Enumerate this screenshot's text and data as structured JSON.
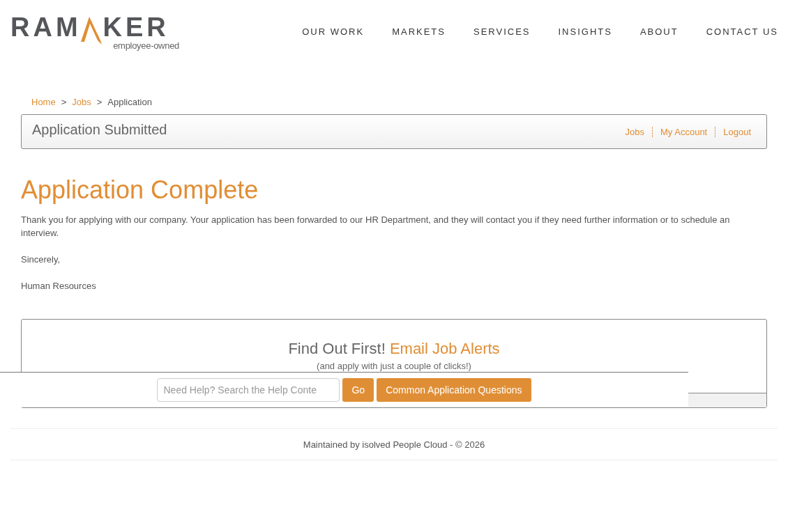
{
  "logo": {
    "left": "RAM",
    "right": "KER",
    "tagline": "employee-owned"
  },
  "nav": [
    "OUR WORK",
    "MARKETS",
    "SERVICES",
    "INSIGHTS",
    "ABOUT",
    "CONTACT US"
  ],
  "breadcrumb": [
    {
      "label": "Home",
      "link": true
    },
    {
      "label": "Jobs",
      "link": true
    },
    {
      "label": "Application",
      "link": false
    }
  ],
  "breadcrumb_separator": ">",
  "panel": {
    "title": "Application Submitted",
    "links": [
      "Jobs",
      "My Account",
      "Logout"
    ]
  },
  "heading": "Application Complete",
  "paragraphs": [
    "Thank you for applying with our company. Your application has been forwarded to our HR Department, and they will contact you if they need further information or to schedule an interview.",
    "Sincerely,",
    "Human Resources"
  ],
  "alerts": {
    "title": "Find Out First!",
    "title_link": "Email Job Alerts",
    "subtitle": "(and apply with just a couple of clicks!)"
  },
  "help_bar": {
    "placeholder": "Need Help? Search the Help Conte",
    "go": "Go",
    "questions": "Common Application Questions"
  },
  "footer": "Maintained by isolved People Cloud - © 2026"
}
